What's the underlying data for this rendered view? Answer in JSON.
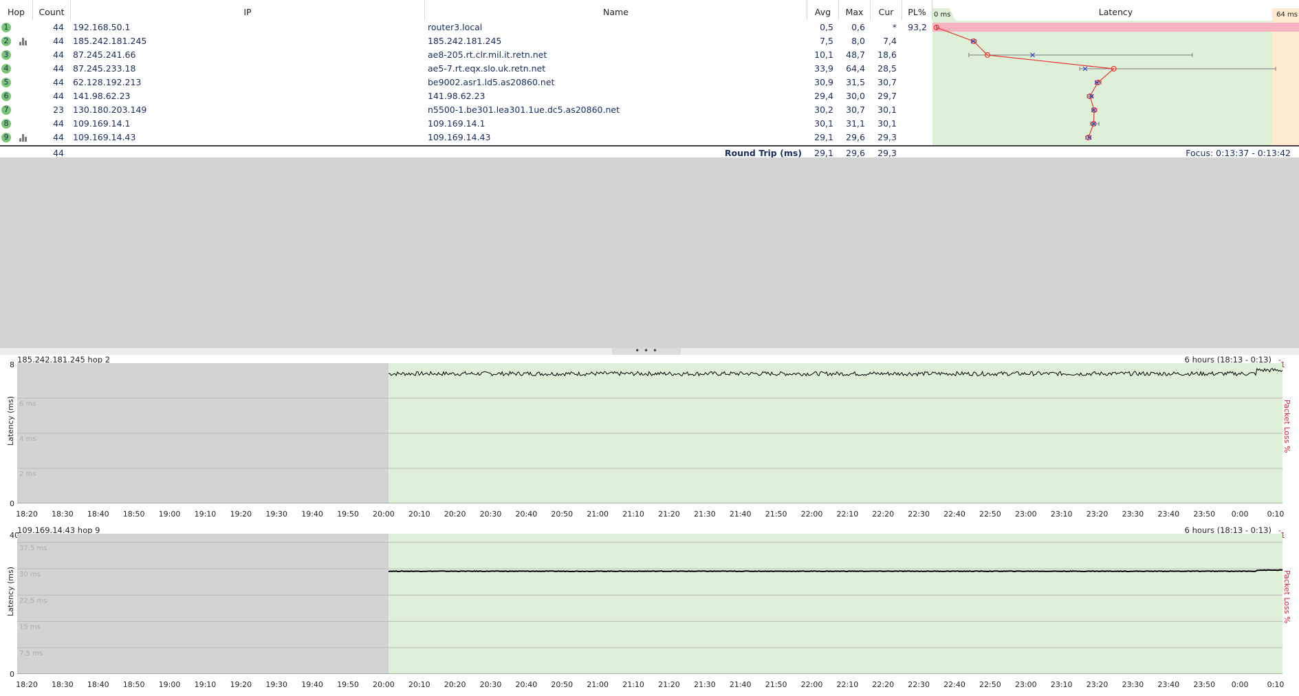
{
  "columns": {
    "hop": "Hop",
    "count": "Count",
    "ip": "IP",
    "name": "Name",
    "avg": "Avg",
    "max": "Max",
    "cur": "Cur",
    "pl": "PL%",
    "latency": "Latency",
    "latency_min": "0 ms",
    "latency_max": "64 ms"
  },
  "hops": [
    {
      "hop": "1",
      "count": "44",
      "ip": "192.168.50.1",
      "name": "router3.local",
      "avg": "0,5",
      "max": "0,6",
      "cur": "*",
      "pl": "93,2",
      "graph_icon": false
    },
    {
      "hop": "2",
      "count": "44",
      "ip": "185.242.181.245",
      "name": "185.242.181.245",
      "avg": "7,5",
      "max": "8,0",
      "cur": "7,4",
      "pl": "",
      "graph_icon": true
    },
    {
      "hop": "3",
      "count": "44",
      "ip": "87.245.241.66",
      "name": "ae8-205.rt.clr.mil.it.retn.net",
      "avg": "10,1",
      "max": "48,7",
      "cur": "18,6",
      "pl": "",
      "graph_icon": false
    },
    {
      "hop": "4",
      "count": "44",
      "ip": "87.245.233.18",
      "name": "ae5-7.rt.eqx.slo.uk.retn.net",
      "avg": "33,9",
      "max": "64,4",
      "cur": "28,5",
      "pl": "",
      "graph_icon": false
    },
    {
      "hop": "5",
      "count": "44",
      "ip": "62.128.192.213",
      "name": "be9002.asr1.ld5.as20860.net",
      "avg": "30,9",
      "max": "31,5",
      "cur": "30,7",
      "pl": "",
      "graph_icon": false
    },
    {
      "hop": "6",
      "count": "44",
      "ip": "141.98.62.23",
      "name": "141.98.62.23",
      "avg": "29,4",
      "max": "30,0",
      "cur": "29,7",
      "pl": "",
      "graph_icon": false
    },
    {
      "hop": "7",
      "count": "23",
      "ip": "130.180.203.149",
      "name": "n5500-1.be301.lea301.1ue.dc5.as20860.net",
      "avg": "30,2",
      "max": "30,7",
      "cur": "30,1",
      "pl": "",
      "graph_icon": false
    },
    {
      "hop": "8",
      "count": "44",
      "ip": "109.169.14.1",
      "name": "109.169.14.1",
      "avg": "30,1",
      "max": "31,1",
      "cur": "30,1",
      "pl": "",
      "graph_icon": false
    },
    {
      "hop": "9",
      "count": "44",
      "ip": "109.169.14.43",
      "name": "109.169.14.43",
      "avg": "29,1",
      "max": "29,6",
      "cur": "29,3",
      "pl": "",
      "graph_icon": true
    }
  ],
  "latency_chart": {
    "scale_max_ms": 64,
    "points": [
      {
        "hop": 1,
        "min": 0.5,
        "avg": 0.5,
        "max": 0.6,
        "cur": null,
        "loss": true
      },
      {
        "hop": 2,
        "min": 7.2,
        "avg": 7.5,
        "max": 8.0,
        "cur": 7.4
      },
      {
        "hop": 3,
        "min": 6.6,
        "avg": 10.1,
        "max": 48.7,
        "cur": 18.6
      },
      {
        "hop": 4,
        "min": 27.5,
        "avg": 33.9,
        "max": 64.4,
        "cur": 28.5
      },
      {
        "hop": 5,
        "min": 30.4,
        "avg": 30.9,
        "max": 31.5,
        "cur": 30.7
      },
      {
        "hop": 6,
        "min": 28.9,
        "avg": 29.4,
        "max": 30.0,
        "cur": 29.7
      },
      {
        "hop": 7,
        "min": 29.8,
        "avg": 30.2,
        "max": 30.7,
        "cur": 30.1
      },
      {
        "hop": 8,
        "min": 29.5,
        "avg": 30.1,
        "max": 31.1,
        "cur": 30.1
      },
      {
        "hop": 9,
        "min": 28.6,
        "avg": 29.1,
        "max": 29.6,
        "cur": 29.3
      }
    ]
  },
  "round_trip": {
    "count": "44",
    "label": "Round Trip (ms)",
    "avg": "29,1",
    "max": "29,6",
    "cur": "29,3",
    "focus": "Focus: 0:13:37 - 0:13:42"
  },
  "splitter_grip": "• • •",
  "time_ticks": [
    "18:20",
    "18:30",
    "18:40",
    "18:50",
    "19:00",
    "19:10",
    "19:20",
    "19:30",
    "19:40",
    "19:50",
    "20:00",
    "20:10",
    "20:20",
    "20:30",
    "20:40",
    "20:50",
    "21:00",
    "21:10",
    "21:20",
    "21:30",
    "21:40",
    "21:50",
    "22:00",
    "22:10",
    "22:20",
    "22:30",
    "22:40",
    "22:50",
    "23:00",
    "23:10",
    "23:20",
    "23:30",
    "23:40",
    "23:50",
    "0:00",
    "0:10"
  ],
  "graphs": [
    {
      "title": "185.242.181.245 hop 2",
      "period": "6 hours (18:13 - 0:13)",
      "y_axis_label": "Latency (ms)",
      "right_axis_label": "Packet Loss %",
      "loss_max": "1",
      "y_max": "8",
      "y_min": "0",
      "y_max_ms": 8,
      "gridlines": [
        {
          "value": 6,
          "label": "6 ms"
        },
        {
          "value": 4,
          "label": "4 ms"
        },
        {
          "value": 2,
          "label": "2 ms"
        }
      ],
      "data_start_fraction": 0.2935,
      "latency_value": 7.4,
      "latency_end_value": 7.6,
      "noise": 0.12
    },
    {
      "title": "109.169.14.43 hop 9",
      "period": "6 hours (18:13 - 0:13)",
      "y_axis_label": "Latency (ms)",
      "right_axis_label": "Packet Loss %",
      "loss_max": "1",
      "y_max": "40",
      "y_min": "0",
      "y_max_ms": 40,
      "gridlines": [
        {
          "value": 37.5,
          "label": "37,5 ms"
        },
        {
          "value": 30,
          "label": "30 ms"
        },
        {
          "value": 22.5,
          "label": "22,5 ms"
        },
        {
          "value": 15,
          "label": "15 ms"
        },
        {
          "value": 7.5,
          "label": "7,5 ms"
        }
      ],
      "data_start_fraction": 0.2935,
      "latency_value": 29.3,
      "latency_end_value": 29.6,
      "noise": 0.08
    }
  ],
  "colors": {
    "latency_ok": "#dff0d8",
    "latency_warn": "#fdebd0",
    "loss_band": "#f7b3bf",
    "no_data": "#d3d3d3",
    "graph_line": "#000000",
    "avg_line": "#e53935",
    "text": "#1b2a5e"
  }
}
